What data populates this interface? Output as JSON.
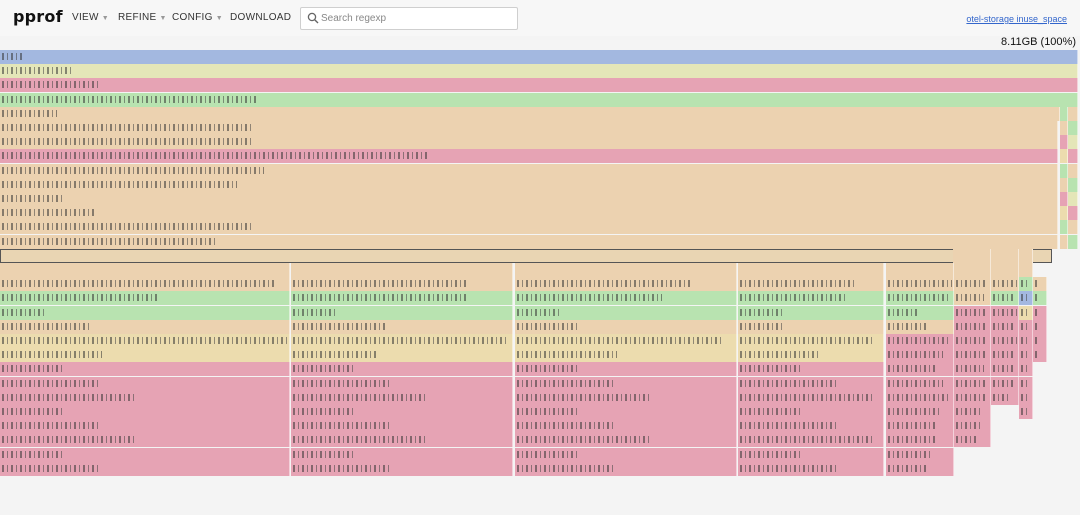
{
  "header": {
    "logo": "pprof",
    "menus": [
      {
        "label": "VIEW"
      },
      {
        "label": "REFINE"
      },
      {
        "label": "CONFIG"
      },
      {
        "label": "DOWNLOAD"
      }
    ],
    "search": {
      "placeholder": "Search regexp",
      "value": ""
    },
    "profile_link": "otel-storage inuse_space"
  },
  "total": "8.11GB (100%)",
  "flame": {
    "closure_frame": "otel_storage::pipeline::transforms::span_index::running_span_index_task::{{closure}}",
    "handlers": [
      "pipeline::transforms::span_index::handle_default_span",
      "span_index::handle_redis_span",
      "transforms::span_index::handle_rpc_span",
      "handle_db_span",
      "send_span_to_kafl",
      "store_with",
      "store_v",
      "poll"
    ],
    "right_labels": [
      "{{closure}}",
      "{{closur",
      "poll"
    ]
  }
}
